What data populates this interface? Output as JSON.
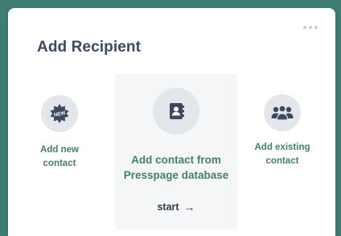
{
  "dialog": {
    "title": "Add Recipient"
  },
  "options": {
    "new_contact": {
      "label_line1": "Add new",
      "label_line2": "contact",
      "icon": "new-badge-icon"
    },
    "from_database": {
      "label_line1": "Add contact from",
      "label_line2": "Presspage database",
      "icon": "address-book-icon",
      "start_label": "start",
      "start_arrow": "→"
    },
    "existing_contact": {
      "label_line1": "Add existing",
      "label_line2": "contact",
      "icon": "people-group-icon"
    }
  },
  "colors": {
    "background": "#3f7c72",
    "accent_label": "#45806f",
    "title": "#3b4a5e",
    "icon_circle": "#e3e6ea",
    "icon_glyph": "#3b4a5e"
  }
}
